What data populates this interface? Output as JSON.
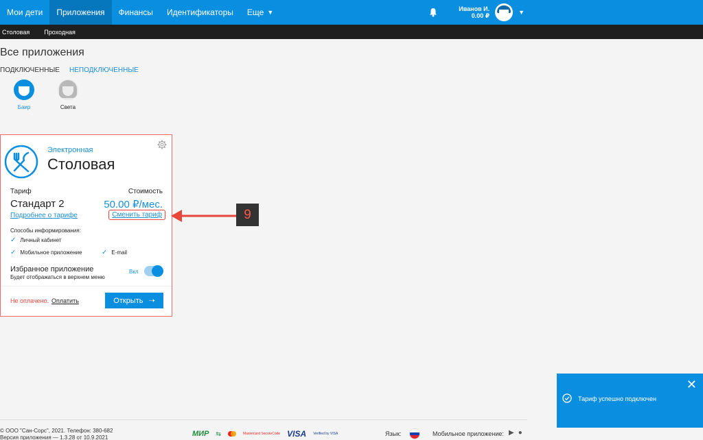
{
  "nav": {
    "items": [
      {
        "label": "Мои дети",
        "active": false
      },
      {
        "label": "Приложения",
        "active": true
      },
      {
        "label": "Финансы",
        "active": false
      },
      {
        "label": "Идентификаторы",
        "active": false
      },
      {
        "label": "Еще",
        "active": false
      }
    ],
    "user_name": "Иванов И.",
    "user_balance": "0.00 ₽"
  },
  "subnav": {
    "items": [
      "Столовая",
      "Проходная"
    ]
  },
  "page": {
    "title": "Все приложения",
    "tabs": [
      "ПОДКЛЮЧЕННЫЕ",
      "НЕПОДКЛЮЧЕННЫЕ"
    ]
  },
  "kids": [
    {
      "name": "Баир",
      "selected": true
    },
    {
      "name": "Света",
      "selected": false
    }
  ],
  "card": {
    "subtitle": "Электронная",
    "title": "Столовая",
    "tariff_label": "Тариф",
    "cost_label": "Стоимость",
    "tariff_name": "Стандарт 2",
    "price": "50.00 ₽/мес.",
    "more_link": "Подробнее о тарифе",
    "change_link": "Сменить тариф",
    "notif_title": "Способы информирования:",
    "notif": [
      "Личный кабинет",
      "Мобильное приложение",
      "E-mail"
    ],
    "fav_title": "Избранное приложение",
    "fav_sub": "Будет отображаться в верхнем меню",
    "fav_state": "Вкл",
    "unpaid": "Не оплачено.",
    "pay_link": "Оплатить",
    "open_button": "Открыть"
  },
  "annotation": {
    "number": "9",
    "color": "#e8463b"
  },
  "toast": {
    "text": "Тариф успешно подключен"
  },
  "footer": {
    "copyright": "© ООО \"Сан-Сорс\", 2021. Телефон: 380-682",
    "version": "Версия приложения — 1.3.28 от 10.9.2021",
    "pay_logos": {
      "mir": "МИР",
      "mastercard": "Mastercard SecureCode",
      "visa": "VISA",
      "verified": "Verified by VISA"
    },
    "lang_label": "Язык:",
    "mobile_label": "Мобильное приложение:"
  },
  "colors": {
    "accent": "#0a8fe0",
    "subnav": "#1f1f1f",
    "annotation": "#e8463b"
  }
}
